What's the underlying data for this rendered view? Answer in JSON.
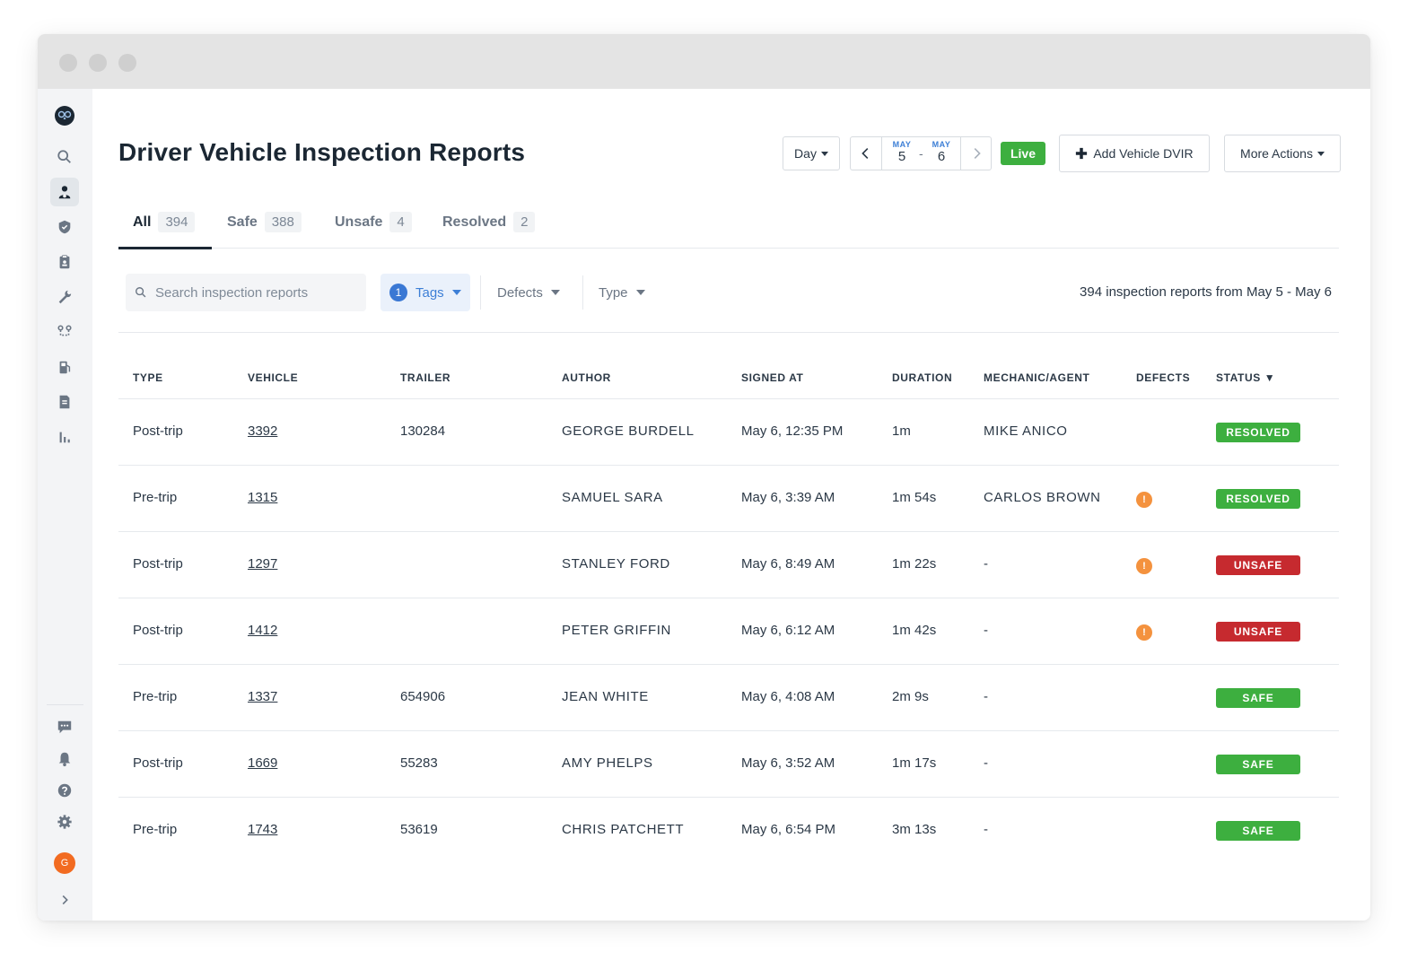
{
  "header": {
    "title": "Driver Vehicle Inspection Reports",
    "day_label": "Day",
    "date_range": {
      "start_month": "MAY",
      "start_day": "5",
      "end_month": "MAY",
      "end_day": "6",
      "separator": "-"
    },
    "live_label": "Live",
    "add_button_label": "Add Vehicle DVIR",
    "more_actions_label": "More Actions"
  },
  "tabs": [
    {
      "label": "All",
      "count": "394"
    },
    {
      "label": "Safe",
      "count": "388"
    },
    {
      "label": "Unsafe",
      "count": "4"
    },
    {
      "label": "Resolved",
      "count": "2"
    }
  ],
  "filters": {
    "search_placeholder": "Search inspection reports",
    "tags_badge": "1",
    "tags_label": "Tags",
    "defects_label": "Defects",
    "type_label": "Type",
    "summary": "394 inspection reports from May 5 - May 6"
  },
  "table": {
    "columns": [
      "TYPE",
      "VEHICLE",
      "TRAILER",
      "AUTHOR",
      "SIGNED AT",
      "DURATION",
      "MECHANIC/AGENT",
      "DEFECTS",
      "STATUS ▼"
    ],
    "rows": [
      {
        "type": "Post-trip",
        "vehicle": "3392",
        "trailer": "130284",
        "author": "GEORGE BURDELL",
        "signed_at": "May 6, 12:35 PM",
        "duration": "1m",
        "mechanic": "MIKE ANICO",
        "defect": "",
        "status": "RESOLVED"
      },
      {
        "type": "Pre-trip",
        "vehicle": "1315",
        "trailer": "",
        "author": "SAMUEL SARA",
        "signed_at": "May 6, 3:39 AM",
        "duration": "1m 54s",
        "mechanic": "CARLOS BROWN",
        "defect": "!",
        "status": "RESOLVED"
      },
      {
        "type": "Post-trip",
        "vehicle": "1297",
        "trailer": "",
        "author": "STANLEY FORD",
        "signed_at": "May 6, 8:49 AM",
        "duration": "1m 22s",
        "mechanic": "-",
        "defect": "!",
        "status": "UNSAFE"
      },
      {
        "type": "Post-trip",
        "vehicle": "1412",
        "trailer": "",
        "author": "PETER GRIFFIN",
        "signed_at": "May 6, 6:12 AM",
        "duration": "1m 42s",
        "mechanic": "-",
        "defect": "!",
        "status": "UNSAFE"
      },
      {
        "type": "Pre-trip",
        "vehicle": "1337",
        "trailer": "654906",
        "author": "JEAN WHITE",
        "signed_at": "May 6, 4:08 AM",
        "duration": "2m 9s",
        "mechanic": "-",
        "defect": "",
        "status": "SAFE"
      },
      {
        "type": "Post-trip",
        "vehicle": "1669",
        "trailer": "55283",
        "author": "AMY PHELPS",
        "signed_at": "May 6, 3:52 AM",
        "duration": "1m 17s",
        "mechanic": "-",
        "defect": "",
        "status": "SAFE"
      },
      {
        "type": "Pre-trip",
        "vehicle": "1743",
        "trailer": "53619",
        "author": "CHRIS PATCHETT",
        "signed_at": "May 6, 6:54 PM",
        "duration": "3m 13s",
        "mechanic": "-",
        "defect": "",
        "status": "SAFE"
      }
    ]
  },
  "status_colors": {
    "RESOLVED": "#3daf3f",
    "SAFE": "#3daf3f",
    "UNSAFE": "#c62a2f"
  },
  "sidebar": {
    "items": [
      {
        "icon": "owl-logo-icon"
      },
      {
        "icon": "search-icon"
      },
      {
        "icon": "driver-icon"
      },
      {
        "icon": "shield-icon"
      },
      {
        "icon": "clipboard-icon"
      },
      {
        "icon": "wrench-icon"
      },
      {
        "icon": "route-icon"
      },
      {
        "icon": "fuel-icon"
      },
      {
        "icon": "document-icon"
      },
      {
        "icon": "reports-chart-icon"
      }
    ],
    "bottom_items": [
      {
        "icon": "chat-icon"
      },
      {
        "icon": "bell-icon"
      },
      {
        "icon": "help-icon"
      },
      {
        "icon": "gear-icon"
      }
    ],
    "avatar_initial": "G"
  }
}
